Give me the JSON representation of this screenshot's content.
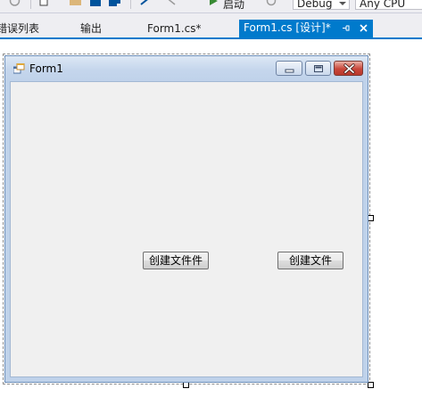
{
  "toolbar": {
    "start_label": "启动",
    "config_value": "Debug",
    "platform_value": "Any CPU"
  },
  "tabs": [
    {
      "label": "错误列表"
    },
    {
      "label": "输出"
    },
    {
      "label": "Form1.cs*"
    },
    {
      "label": "Form1.cs [设计]*",
      "active": true
    }
  ],
  "form": {
    "title": "Form1",
    "buttons": [
      {
        "label": "创建文件件"
      },
      {
        "label": "创建文件"
      }
    ]
  },
  "colors": {
    "accent": "#007acc",
    "form_background": "#f0f0f0",
    "close_button": "#c9463a"
  }
}
